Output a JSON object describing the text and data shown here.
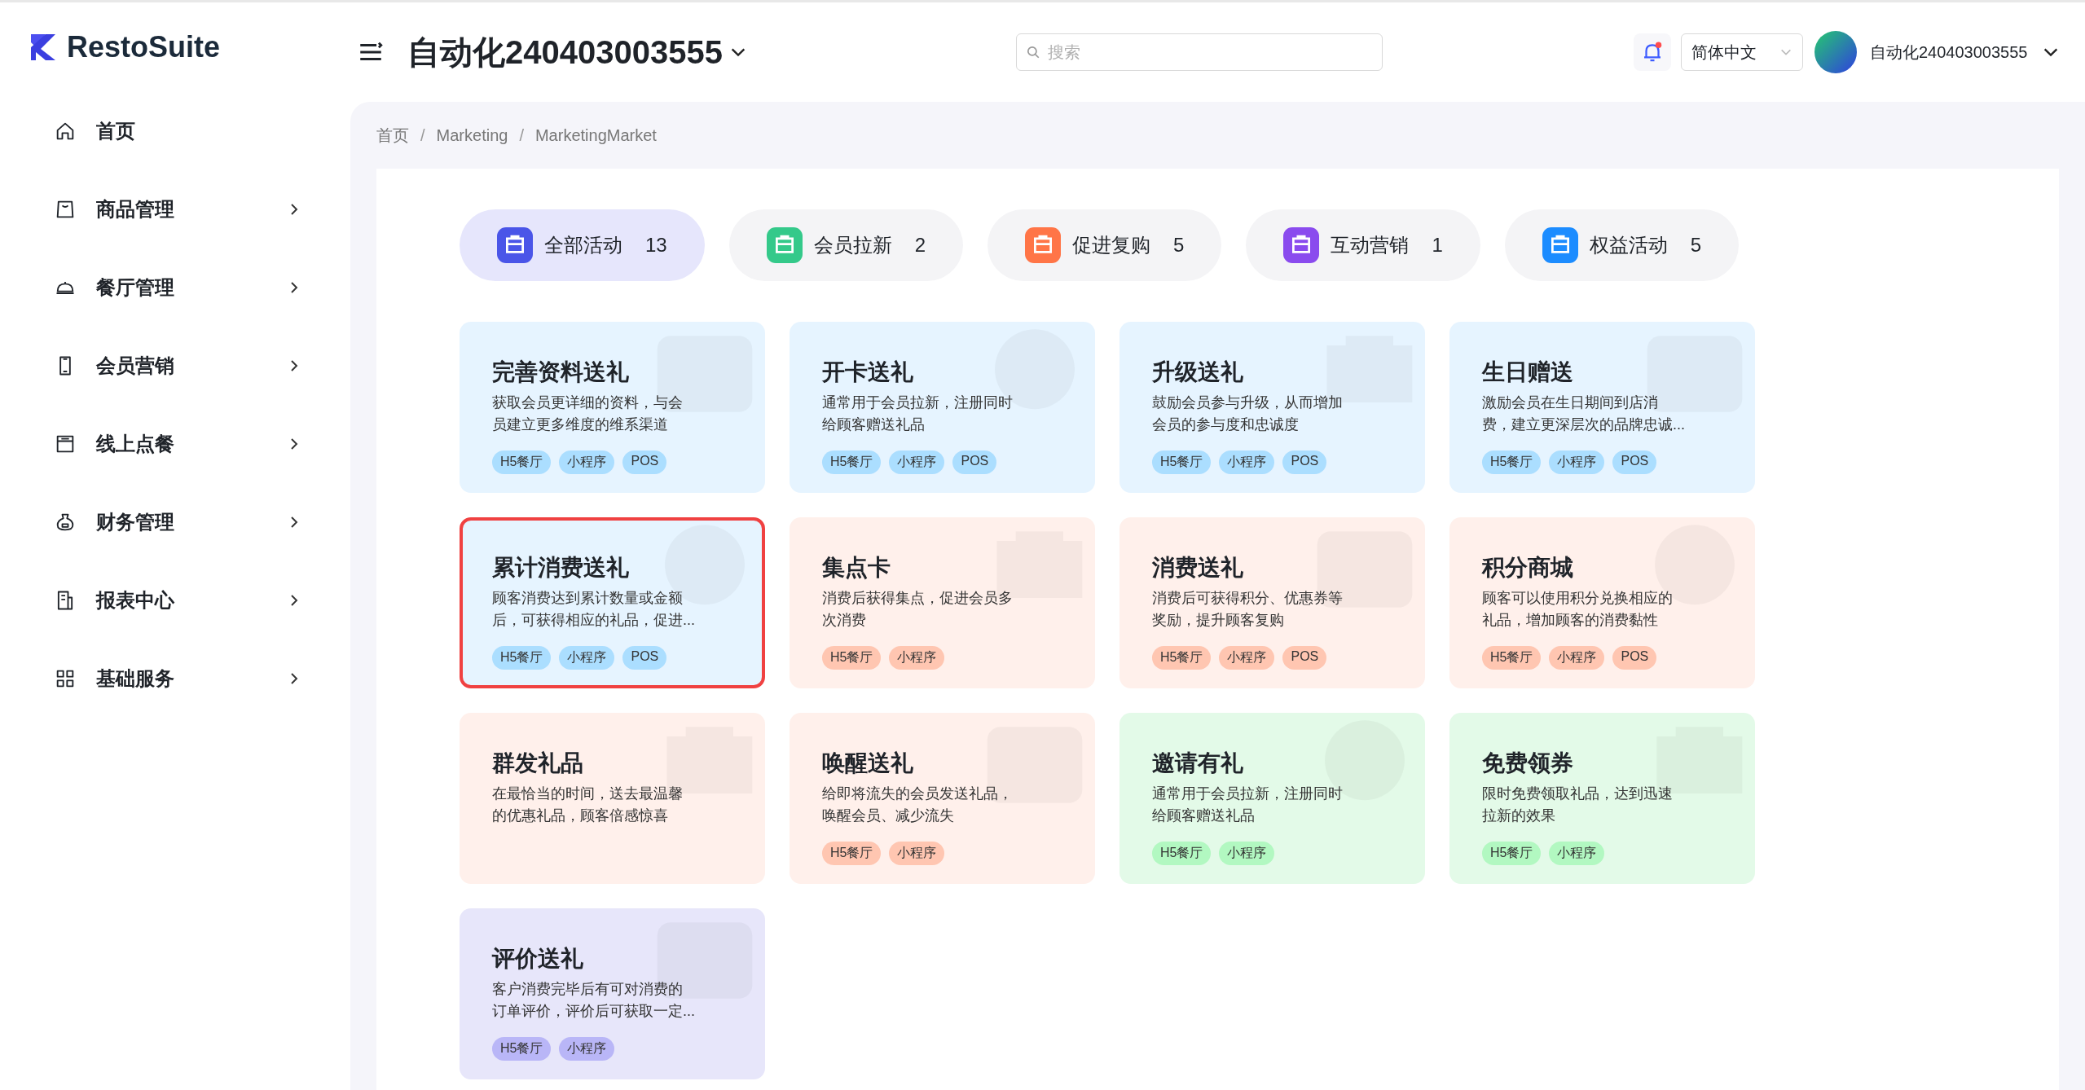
{
  "logo": {
    "text": "RestoSuite"
  },
  "header": {
    "store_name": "自动化240403003555",
    "search": {
      "placeholder": "搜索"
    },
    "notification": {
      "unread": true
    },
    "language": "简体中文",
    "user_name": "自动化240403003555"
  },
  "sidebar": {
    "items": [
      {
        "label": "首页",
        "expandable": false
      },
      {
        "label": "商品管理",
        "expandable": true
      },
      {
        "label": "餐厅管理",
        "expandable": true
      },
      {
        "label": "会员营销",
        "expandable": true
      },
      {
        "label": "线上点餐",
        "expandable": true
      },
      {
        "label": "财务管理",
        "expandable": true
      },
      {
        "label": "报表中心",
        "expandable": true
      },
      {
        "label": "基础服务",
        "expandable": true
      }
    ]
  },
  "breadcrumb": {
    "separator": "/",
    "items": [
      "首页",
      "Marketing",
      "MarketingMarket"
    ]
  },
  "tabs": [
    {
      "label": "全部活动",
      "count": "13",
      "selected": true,
      "color": "#4a55e8"
    },
    {
      "label": "会员拉新",
      "count": "2",
      "selected": false,
      "color": "#34c98a"
    },
    {
      "label": "促进复购",
      "count": "5",
      "selected": false,
      "color": "#ff7547"
    },
    {
      "label": "互动营销",
      "count": "1",
      "selected": false,
      "color": "#8a4bee"
    },
    {
      "label": "权益活动",
      "count": "5",
      "selected": false,
      "color": "#1c8cff"
    }
  ],
  "cards": [
    {
      "title": "完善资料送礼",
      "description": [
        "获取会员更详细的资料，与会",
        "员建立更多维度的维系渠道"
      ],
      "tags": [
        "H5餐厅",
        "小程序",
        "POS"
      ],
      "selected": false,
      "color": "#e6f4ff"
    },
    {
      "title": "开卡送礼",
      "description": [
        "通常用于会员拉新，注册同时",
        "给顾客赠送礼品"
      ],
      "tags": [
        "H5餐厅",
        "小程序",
        "POS"
      ],
      "selected": false,
      "color": "#e6f4ff"
    },
    {
      "title": "升级送礼",
      "description": [
        "鼓励会员参与升级，从而增加",
        "会员的参与度和忠诚度"
      ],
      "tags": [
        "H5餐厅",
        "小程序",
        "POS"
      ],
      "selected": false,
      "color": "#e6f4ff"
    },
    {
      "title": "生日赠送",
      "description": [
        "激励会员在生日期间到店消",
        "费，建立更深层次的品牌忠诚..."
      ],
      "tags": [
        "H5餐厅",
        "小程序",
        "POS"
      ],
      "selected": false,
      "color": "#e6f4ff"
    },
    {
      "title": "累计消费送礼",
      "description": [
        "顾客消费达到累计数量或金额",
        "后，可获得相应的礼品，促进..."
      ],
      "tags": [
        "H5餐厅",
        "小程序",
        "POS"
      ],
      "selected": true,
      "color": "#e6f4ff"
    },
    {
      "title": "集点卡",
      "description": [
        "消费后获得集点，促进会员多",
        "次消费"
      ],
      "tags": [
        "H5餐厅",
        "小程序"
      ],
      "selected": false,
      "color": "#fff0eb"
    },
    {
      "title": "消费送礼",
      "description": [
        "消费后可获得积分、优惠券等",
        "奖励，提升顾客复购"
      ],
      "tags": [
        "H5餐厅",
        "小程序",
        "POS"
      ],
      "selected": false,
      "color": "#fff0eb"
    },
    {
      "title": "积分商城",
      "description": [
        "顾客可以使用积分兑换相应的",
        "礼品，增加顾客的消费黏性"
      ],
      "tags": [
        "H5餐厅",
        "小程序",
        "POS"
      ],
      "selected": false,
      "color": "#fff0eb"
    },
    {
      "title": "群发礼品",
      "description": [
        "在最恰当的时间，送去最温馨",
        "的优惠礼品，顾客倍感惊喜"
      ],
      "selected": false,
      "color": "#fff0eb"
    },
    {
      "title": "唤醒送礼",
      "description": [
        "给即将流失的会员发送礼品，",
        "唤醒会员、减少流失"
      ],
      "tags": [
        "H5餐厅",
        "小程序"
      ],
      "selected": false,
      "color": "#fff0eb"
    },
    {
      "title": "邀请有礼",
      "description": [
        "通常用于会员拉新，注册同时",
        "给顾客赠送礼品"
      ],
      "tags": [
        "H5餐厅",
        "小程序"
      ],
      "selected": false,
      "color": "#e3fae8"
    },
    {
      "title": "免费领券",
      "description": [
        "限时免费领取礼品，达到迅速",
        "拉新的效果"
      ],
      "tags": [
        "H5餐厅",
        "小程序"
      ],
      "selected": false,
      "color": "#e3fae8"
    },
    {
      "title": "评价送礼",
      "description": [
        "客户消费完毕后有可对消费的",
        "订单评价，评价后可获取一定..."
      ],
      "tags": [
        "H5餐厅",
        "小程序"
      ],
      "selected": false,
      "color": "#e7e6fa"
    }
  ]
}
